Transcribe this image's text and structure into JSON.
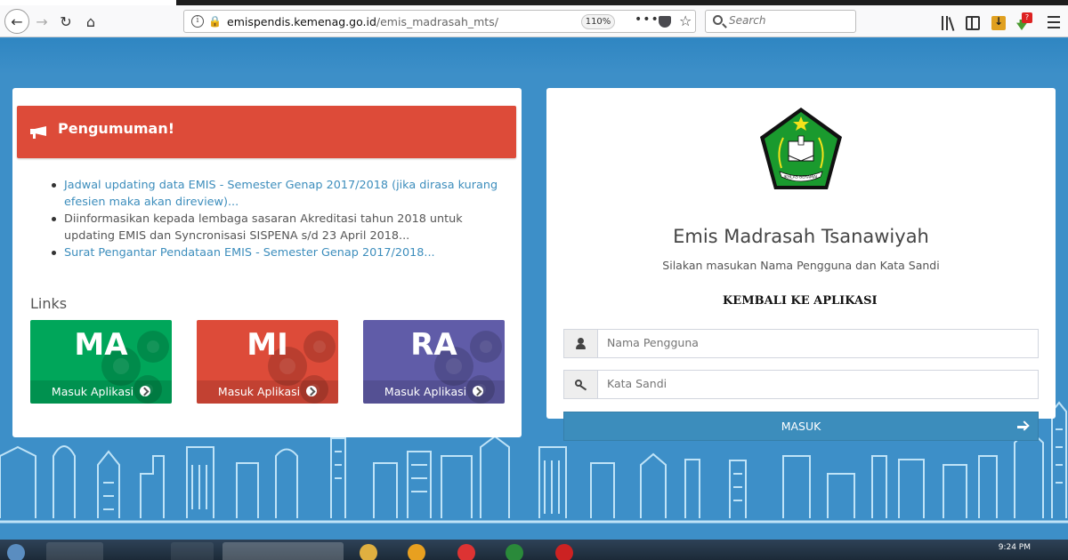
{
  "browser": {
    "url_host": "emispendis.kemenag.go.id",
    "url_path": "/emis_madrasah_mts/",
    "zoom": "110%",
    "search_placeholder": "Search"
  },
  "announcement": {
    "title": "Pengumuman!",
    "items": [
      "Jadwal updating data EMIS - Semester Genap 2017/2018 (jika dirasa kurang efesien maka akan direview)...",
      "Diinformasikan kepada lembaga sasaran Akreditasi tahun 2018 untuk updating EMIS dan Syncronisasi SISPENA s/d 23 April 2018...",
      "Surat Pengantar Pendataan EMIS - Semester Genap 2017/2018..."
    ]
  },
  "links": {
    "title": "Links",
    "apps": [
      {
        "code": "MA",
        "label": "Masuk Aplikasi",
        "color": "#00a65a"
      },
      {
        "code": "MI",
        "label": "Masuk Aplikasi",
        "color": "#dd4b39"
      },
      {
        "code": "RA",
        "label": "Masuk Aplikasi",
        "color": "#605ca8"
      }
    ]
  },
  "login": {
    "logo_text": "IKHLAS BERAMAL",
    "title": "Emis Madrasah Tsanawiyah",
    "subtitle": "Silakan masukan Nama Pengguna dan Kata Sandi",
    "username_placeholder": "Nama Pengguna",
    "password_placeholder": "Kata Sandi",
    "overlay_text": "KEMBALI KE APLIKASI",
    "submit_label": "MASUK"
  },
  "taskbar": {
    "time": "9:24 PM"
  },
  "colors": {
    "background": "#3d8fc8",
    "announcement": "#dd4b39",
    "primary": "#3c8dbc"
  }
}
